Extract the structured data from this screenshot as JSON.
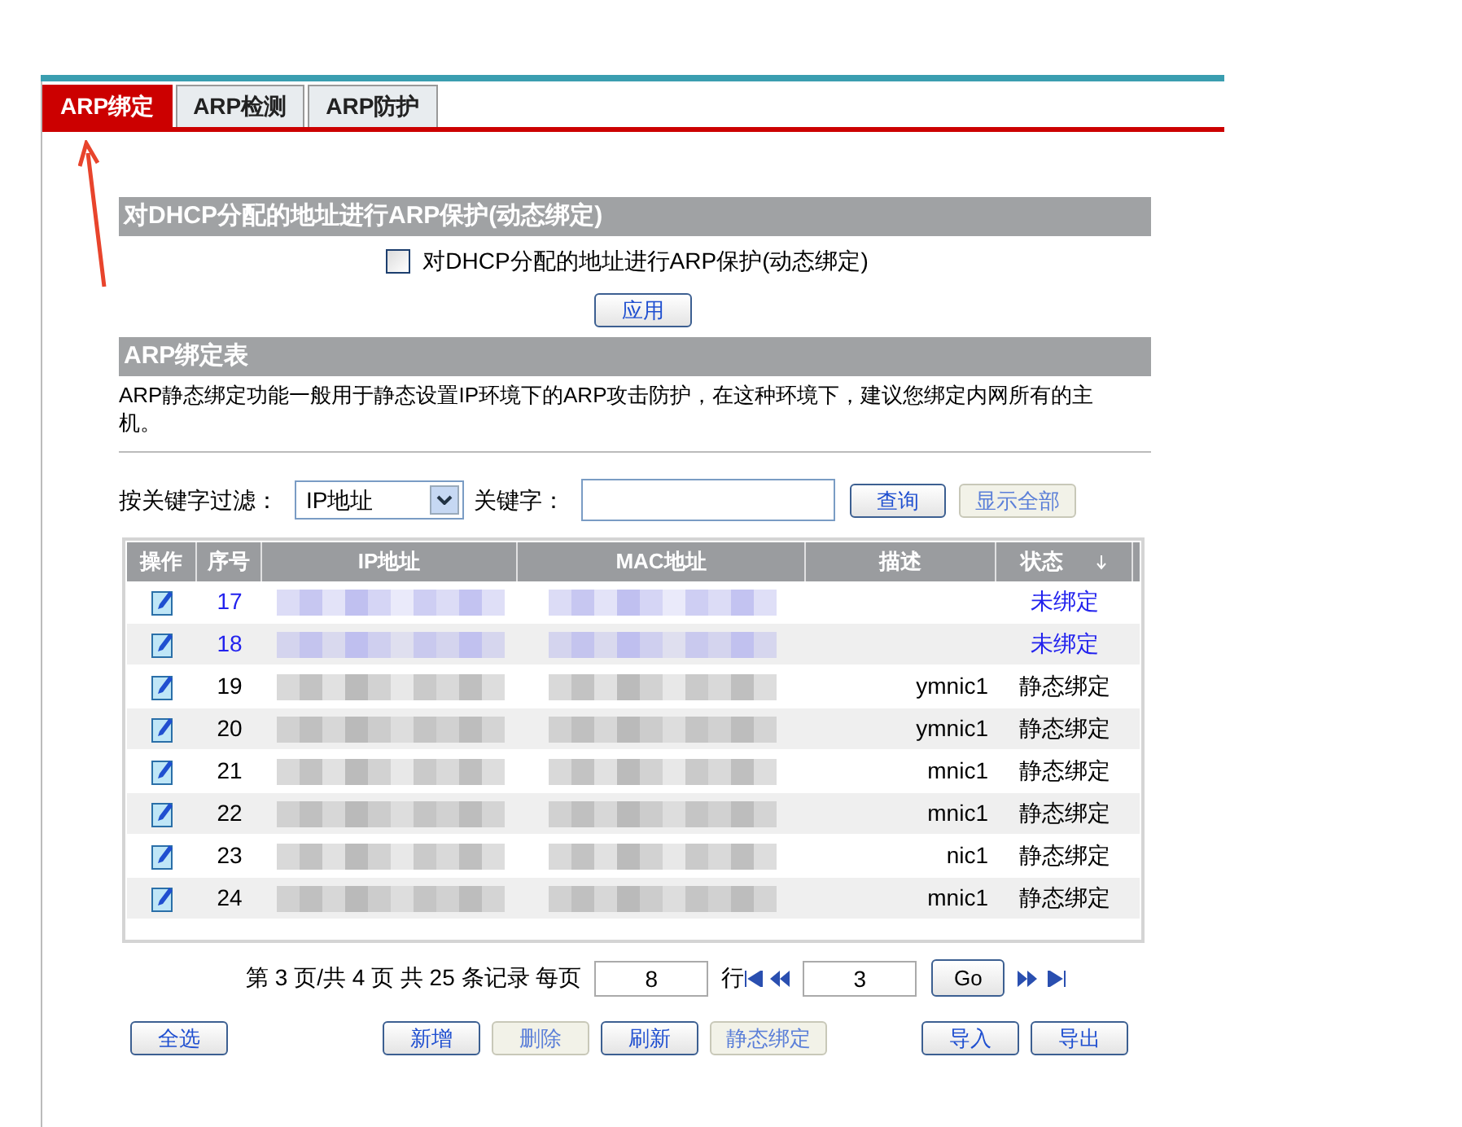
{
  "tabs": [
    {
      "label": "ARP绑定",
      "selected": true
    },
    {
      "label": "ARP检测",
      "selected": false
    },
    {
      "label": "ARP防护",
      "selected": false
    }
  ],
  "dhcp_section": {
    "title": "对DHCP分配的地址进行ARP保护(动态绑定)",
    "checkbox": {
      "label": "对DHCP分配的地址进行ARP保护(动态绑定)",
      "checked": false
    },
    "apply_button": "应用"
  },
  "table_section": {
    "title": "ARP绑定表",
    "description": "ARP静态绑定功能一般用于静态设置IP环境下的ARP攻击防护，在这种环境下，建议您绑定内网所有的主机。"
  },
  "filter": {
    "label": "按关键字过滤：",
    "select_value": "IP地址",
    "keyword_label": "关键字：",
    "query_button": "查询",
    "show_all_button": "显示全部"
  },
  "table": {
    "columns": [
      "操作",
      "序号",
      "IP地址",
      "MAC地址",
      "描述",
      "状态"
    ],
    "rows": [
      {
        "index": "17",
        "description": "",
        "status": "未绑定",
        "bound": false
      },
      {
        "index": "18",
        "description": "",
        "status": "未绑定",
        "bound": false
      },
      {
        "index": "19",
        "description": "ymnic1",
        "status": "静态绑定",
        "bound": true
      },
      {
        "index": "20",
        "description": "ymnic1",
        "status": "静态绑定",
        "bound": true
      },
      {
        "index": "21",
        "description": "mnic1",
        "status": "静态绑定",
        "bound": true
      },
      {
        "index": "22",
        "description": "mnic1",
        "status": "静态绑定",
        "bound": true
      },
      {
        "index": "23",
        "description": "nic1",
        "status": "静态绑定",
        "bound": true
      },
      {
        "index": "24",
        "description": "mnic1",
        "status": "静态绑定",
        "bound": true
      }
    ]
  },
  "pagination": {
    "info": "第 3 页/共 4 页 共 25 条记录 每页",
    "per_page": "8",
    "rows_label": "行",
    "page": "3",
    "go_button": "Go"
  },
  "actions": [
    {
      "label": "全选",
      "disabled": false
    },
    {
      "label": "新增",
      "disabled": false
    },
    {
      "label": "删除",
      "disabled": true
    },
    {
      "label": "刷新",
      "disabled": false
    },
    {
      "label": "静态绑定",
      "disabled": true
    },
    {
      "label": "导入",
      "disabled": false
    },
    {
      "label": "导出",
      "disabled": false
    }
  ]
}
